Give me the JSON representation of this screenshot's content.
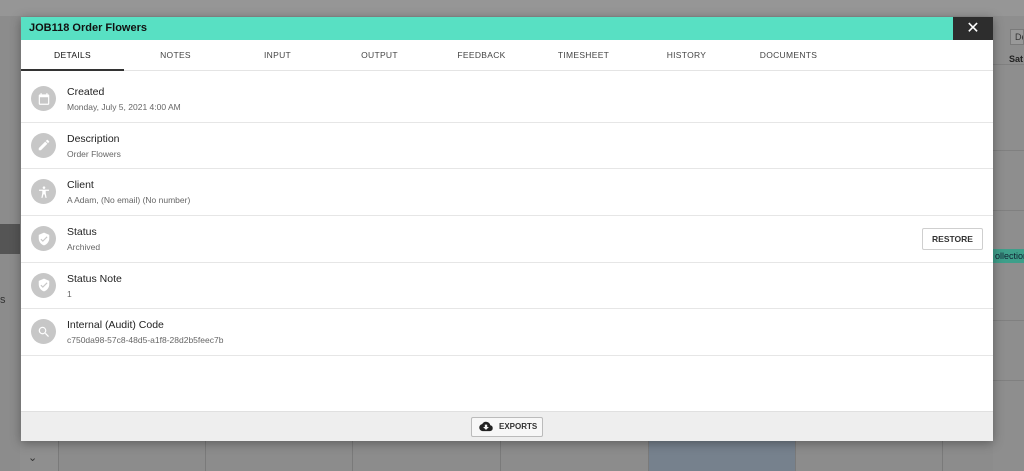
{
  "background": {
    "left_letter": "s",
    "right_tab": "De",
    "right_day": "Sat",
    "right_event": "ollection",
    "chevron": "⌄"
  },
  "modal": {
    "title": "JOB118 Order Flowers",
    "close_glyph": "✕",
    "header_color": "#58e0c3"
  },
  "tabs": [
    {
      "label": "DETAILS",
      "active": true
    },
    {
      "label": "NOTES"
    },
    {
      "label": "INPUT"
    },
    {
      "label": "OUTPUT"
    },
    {
      "label": "FEEDBACK"
    },
    {
      "label": "TIMESHEET"
    },
    {
      "label": "HISTORY"
    },
    {
      "label": "DOCUMENTS"
    }
  ],
  "details": [
    {
      "icon": "calendar-icon",
      "label": "Created",
      "value": "Monday, July 5, 2021 4:00 AM"
    },
    {
      "icon": "pencil-icon",
      "label": "Description",
      "value": "Order Flowers"
    },
    {
      "icon": "person-icon",
      "label": "Client",
      "value": "A Adam, (No email) (No number)"
    },
    {
      "icon": "shield-check-icon",
      "label": "Status",
      "value": "Archived"
    },
    {
      "icon": "shield-check-icon",
      "label": "Status Note",
      "value": "1"
    },
    {
      "icon": "search-icon",
      "label": "Internal (Audit) Code",
      "value": "c750da98-57c8-48d5-a1f8-28d2b5feec7b"
    }
  ],
  "actions": {
    "restore_label": "RESTORE",
    "exports_label": "EXPORTS"
  }
}
